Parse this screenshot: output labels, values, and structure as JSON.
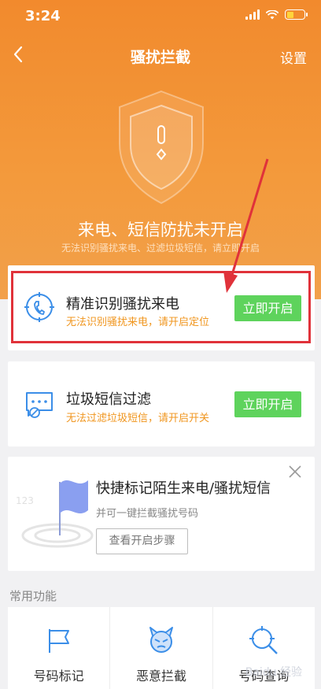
{
  "status_bar": {
    "time": "3:24"
  },
  "nav": {
    "title": "骚扰拦截",
    "settings_label": "设置",
    "back_icon": "back-chevron-icon"
  },
  "hero": {
    "icon": "shield-alert-icon",
    "title": "来电、短信防扰未开启",
    "subtitle": "无法识别骚扰来电、过滤垃圾短信，请立即开启"
  },
  "cards": [
    {
      "icon": "phone-location-icon",
      "title": "精准识别骚扰来电",
      "subtitle": "无法识别骚扰来电，请开启定位",
      "button": "立即开启"
    },
    {
      "icon": "sms-block-icon",
      "title": "垃圾短信过滤",
      "subtitle": "无法过滤垃圾短信，请开启开关",
      "button": "立即开启"
    }
  ],
  "quick_mark": {
    "icon": "flag-icon",
    "title": "快捷标记陌生来电/骚扰短信",
    "subtitle": "并可一键拦截骚扰号码",
    "button": "查看开启步骤"
  },
  "common_functions": {
    "label": "常用功能",
    "items": [
      {
        "icon": "flag-mark-icon",
        "label": "号码标记"
      },
      {
        "icon": "devil-face-icon",
        "label": "恶意拦截"
      },
      {
        "icon": "search-number-icon",
        "label": "号码查询"
      }
    ]
  },
  "watermark": "Baidu 经验",
  "colors": {
    "accent_orange": "#f28a2d",
    "button_green": "#5ed35c",
    "warning_orange": "#f0961f",
    "highlight_red": "#e0323a"
  }
}
